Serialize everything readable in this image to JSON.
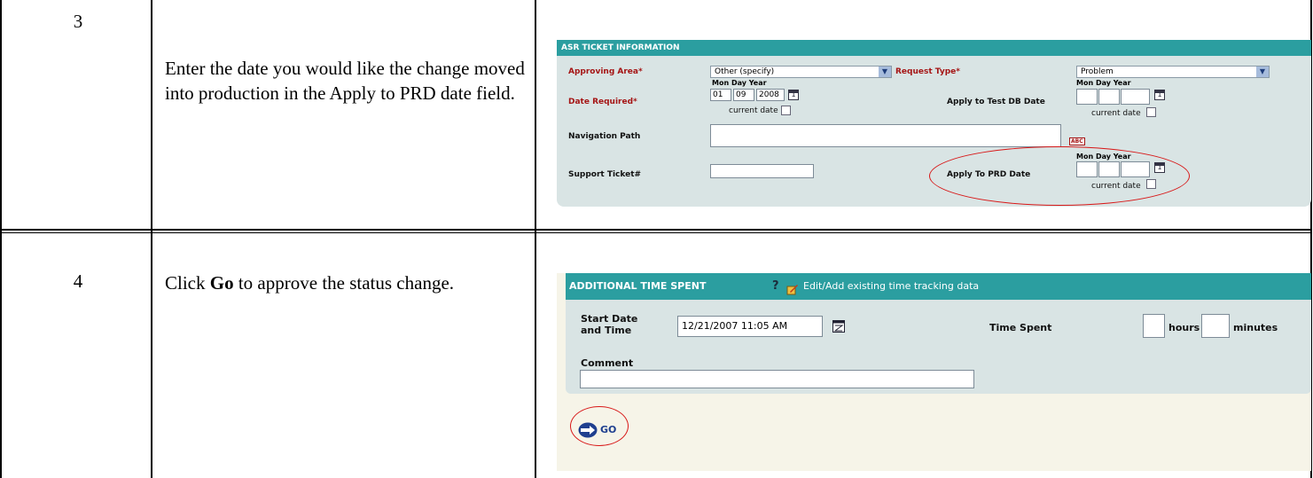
{
  "rows": [
    {
      "step": "3",
      "instruction": "Enter the date you would like the change moved into production in the Apply to PRD date field."
    },
    {
      "step": "4",
      "instruction_prefix": "Click ",
      "instruction_bold": "Go",
      "instruction_suffix": " to approve the status change."
    }
  ],
  "asr_panel": {
    "title": "ASR TICKET INFORMATION",
    "approving_area_label": "Approving Area*",
    "approving_area_value": "Other (specify)",
    "request_type_label": "Request Type*",
    "request_type_value": "Problem",
    "date_header": "Mon Day  Year",
    "date_required_label": "Date Required*",
    "date_required_mon": "01",
    "date_required_day": "09",
    "date_required_year": "2008",
    "current_date_label": "current date",
    "apply_test_label": "Apply to Test DB Date",
    "navigation_path_label": "Navigation Path",
    "abc_label": "ABC",
    "support_ticket_label": "Support Ticket#",
    "apply_prd_label": "Apply To PRD Date",
    "calendar_glyph": "1"
  },
  "time_panel": {
    "title": "ADDITIONAL TIME SPENT",
    "help_icon": "?",
    "edit_link": "Edit/Add existing time tracking data",
    "start_label": "Start Date and Time",
    "start_value": "12/21/2007 11:05 AM",
    "time_spent_label": "Time Spent",
    "hours_label": "hours",
    "minutes_label": "minutes",
    "comment_label": "Comment",
    "go_label": "GO"
  },
  "colors": {
    "header_bar": "#2b9ea0",
    "panel_bg": "#d9e4e4",
    "required_label": "#a51515",
    "highlight_ellipse": "#d81818"
  },
  "icons": [
    "calendar-icon",
    "help-icon",
    "edit-pencil-icon",
    "go-arrow-icon"
  ]
}
